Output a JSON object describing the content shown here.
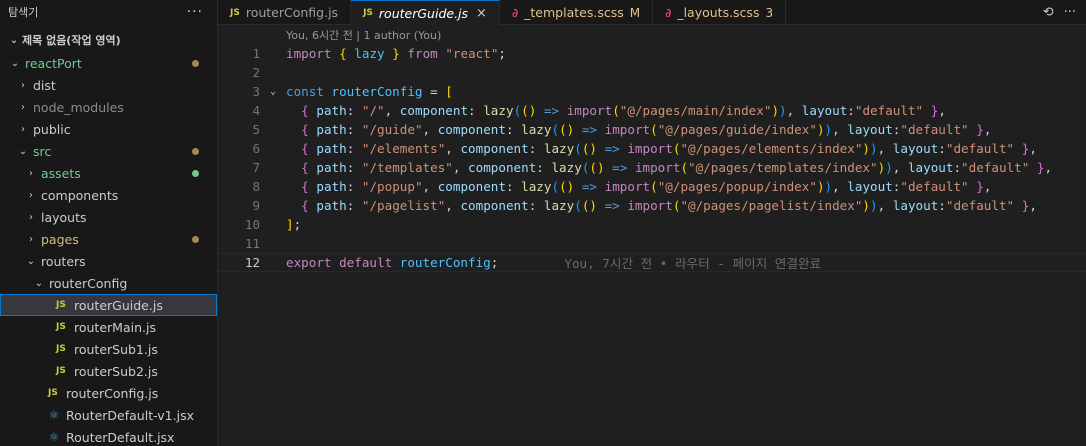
{
  "explorer": {
    "title": "탐색기",
    "more": "···",
    "workspace": "제목 없음(작업 영역)",
    "items": [
      {
        "label": "reactPort",
        "kind": "folder-open",
        "depth": 0,
        "dot": "#a08a4e",
        "color": "green"
      },
      {
        "label": "dist",
        "kind": "folder",
        "depth": 1
      },
      {
        "label": "node_modules",
        "kind": "folder",
        "depth": 1,
        "dim": true
      },
      {
        "label": "public",
        "kind": "folder",
        "depth": 1
      },
      {
        "label": "src",
        "kind": "folder-open",
        "depth": 1,
        "dot": "#a08a4e",
        "color": "green"
      },
      {
        "label": "assets",
        "kind": "folder",
        "depth": 2,
        "dot": "#73c991",
        "color": "green"
      },
      {
        "label": "components",
        "kind": "folder",
        "depth": 2
      },
      {
        "label": "layouts",
        "kind": "folder",
        "depth": 2
      },
      {
        "label": "pages",
        "kind": "folder",
        "depth": 2,
        "dot": "#a08a4e"
      },
      {
        "label": "routers",
        "kind": "folder-open",
        "depth": 2
      },
      {
        "label": "routerConfig",
        "kind": "folder-open",
        "depth": 3
      },
      {
        "label": "routerGuide.js",
        "kind": "js",
        "depth": 4,
        "selected": true
      },
      {
        "label": "routerMain.js",
        "kind": "js",
        "depth": 4
      },
      {
        "label": "routerSub1.js",
        "kind": "js",
        "depth": 4
      },
      {
        "label": "routerSub2.js",
        "kind": "js",
        "depth": 4
      },
      {
        "label": "routerConfig.js",
        "kind": "js",
        "depth": 3
      },
      {
        "label": "RouterDefault-v1.jsx",
        "kind": "react",
        "depth": 3
      },
      {
        "label": "RouterDefault.jsx",
        "kind": "react",
        "depth": 3
      }
    ]
  },
  "tabs": [
    {
      "label": "routerConfig.js",
      "icon": "js",
      "active": false
    },
    {
      "label": "routerGuide.js",
      "icon": "js",
      "active": true,
      "close": "×"
    },
    {
      "label": "_templates.scss",
      "icon": "sass",
      "active": false,
      "badge": "M"
    },
    {
      "label": "_layouts.scss",
      "icon": "sass",
      "active": false,
      "badge": "3"
    }
  ],
  "editor": {
    "codelens": "You, 6시간 전 | 1 author (You)",
    "blame": "You, 7시간 전 • 라우터 - 페이지 연결완료",
    "current_line": 12,
    "lines": [
      [
        {
          "c": "kw",
          "t": "import"
        },
        {
          "c": "txt",
          "t": " "
        },
        {
          "c": "p1",
          "t": "{"
        },
        {
          "c": "txt",
          "t": " "
        },
        {
          "c": "var",
          "t": "lazy"
        },
        {
          "c": "txt",
          "t": " "
        },
        {
          "c": "p1",
          "t": "}"
        },
        {
          "c": "txt",
          "t": " "
        },
        {
          "c": "kw",
          "t": "from"
        },
        {
          "c": "txt",
          "t": " "
        },
        {
          "c": "str",
          "t": "\"react\""
        },
        {
          "c": "txt",
          "t": ";"
        }
      ],
      [],
      [
        {
          "c": "kb",
          "t": "const"
        },
        {
          "c": "txt",
          "t": " "
        },
        {
          "c": "var",
          "t": "routerConfig"
        },
        {
          "c": "txt",
          "t": " = "
        },
        {
          "c": "p1",
          "t": "["
        }
      ],
      [
        {
          "c": "txt",
          "t": "  "
        },
        {
          "c": "p2",
          "t": "{"
        },
        {
          "c": "txt",
          "t": " "
        },
        {
          "c": "prop",
          "t": "path"
        },
        {
          "c": "txt",
          "t": ": "
        },
        {
          "c": "str",
          "t": "\"/\""
        },
        {
          "c": "txt",
          "t": ", "
        },
        {
          "c": "prop",
          "t": "component"
        },
        {
          "c": "txt",
          "t": ": "
        },
        {
          "c": "fn",
          "t": "lazy"
        },
        {
          "c": "p3",
          "t": "("
        },
        {
          "c": "p1",
          "t": "()"
        },
        {
          "c": "txt",
          "t": " "
        },
        {
          "c": "kb",
          "t": "=>"
        },
        {
          "c": "txt",
          "t": " "
        },
        {
          "c": "kw",
          "t": "import"
        },
        {
          "c": "p1",
          "t": "("
        },
        {
          "c": "str",
          "t": "\"@/pages/main/index\""
        },
        {
          "c": "p1",
          "t": ")"
        },
        {
          "c": "p3",
          "t": ")"
        },
        {
          "c": "txt",
          "t": ", "
        },
        {
          "c": "prop",
          "t": "layout"
        },
        {
          "c": "txt",
          "t": ":"
        },
        {
          "c": "str",
          "t": "\"default\""
        },
        {
          "c": "txt",
          "t": " "
        },
        {
          "c": "p2",
          "t": "}"
        },
        {
          "c": "txt",
          "t": ","
        }
      ],
      [
        {
          "c": "txt",
          "t": "  "
        },
        {
          "c": "p2",
          "t": "{"
        },
        {
          "c": "txt",
          "t": " "
        },
        {
          "c": "prop",
          "t": "path"
        },
        {
          "c": "txt",
          "t": ": "
        },
        {
          "c": "str",
          "t": "\"/guide\""
        },
        {
          "c": "txt",
          "t": ", "
        },
        {
          "c": "prop",
          "t": "component"
        },
        {
          "c": "txt",
          "t": ": "
        },
        {
          "c": "fn",
          "t": "lazy"
        },
        {
          "c": "p3",
          "t": "("
        },
        {
          "c": "p1",
          "t": "()"
        },
        {
          "c": "txt",
          "t": " "
        },
        {
          "c": "kb",
          "t": "=>"
        },
        {
          "c": "txt",
          "t": " "
        },
        {
          "c": "kw",
          "t": "import"
        },
        {
          "c": "p1",
          "t": "("
        },
        {
          "c": "str",
          "t": "\"@/pages/guide/index\""
        },
        {
          "c": "p1",
          "t": ")"
        },
        {
          "c": "p3",
          "t": ")"
        },
        {
          "c": "txt",
          "t": ", "
        },
        {
          "c": "prop",
          "t": "layout"
        },
        {
          "c": "txt",
          "t": ":"
        },
        {
          "c": "str",
          "t": "\"default\""
        },
        {
          "c": "txt",
          "t": " "
        },
        {
          "c": "p2",
          "t": "}"
        },
        {
          "c": "txt",
          "t": ","
        }
      ],
      [
        {
          "c": "txt",
          "t": "  "
        },
        {
          "c": "p2",
          "t": "{"
        },
        {
          "c": "txt",
          "t": " "
        },
        {
          "c": "prop",
          "t": "path"
        },
        {
          "c": "txt",
          "t": ": "
        },
        {
          "c": "str",
          "t": "\"/elements\""
        },
        {
          "c": "txt",
          "t": ", "
        },
        {
          "c": "prop",
          "t": "component"
        },
        {
          "c": "txt",
          "t": ": "
        },
        {
          "c": "fn",
          "t": "lazy"
        },
        {
          "c": "p3",
          "t": "("
        },
        {
          "c": "p1",
          "t": "()"
        },
        {
          "c": "txt",
          "t": " "
        },
        {
          "c": "kb",
          "t": "=>"
        },
        {
          "c": "txt",
          "t": " "
        },
        {
          "c": "kw",
          "t": "import"
        },
        {
          "c": "p1",
          "t": "("
        },
        {
          "c": "str",
          "t": "\"@/pages/elements/index\""
        },
        {
          "c": "p1",
          "t": ")"
        },
        {
          "c": "p3",
          "t": ")"
        },
        {
          "c": "txt",
          "t": ", "
        },
        {
          "c": "prop",
          "t": "layout"
        },
        {
          "c": "txt",
          "t": ":"
        },
        {
          "c": "str",
          "t": "\"default\""
        },
        {
          "c": "txt",
          "t": " "
        },
        {
          "c": "p2",
          "t": "}"
        },
        {
          "c": "txt",
          "t": ","
        }
      ],
      [
        {
          "c": "txt",
          "t": "  "
        },
        {
          "c": "p2",
          "t": "{"
        },
        {
          "c": "txt",
          "t": " "
        },
        {
          "c": "prop",
          "t": "path"
        },
        {
          "c": "txt",
          "t": ": "
        },
        {
          "c": "str",
          "t": "\"/templates\""
        },
        {
          "c": "txt",
          "t": ", "
        },
        {
          "c": "prop",
          "t": "component"
        },
        {
          "c": "txt",
          "t": ": "
        },
        {
          "c": "fn",
          "t": "lazy"
        },
        {
          "c": "p3",
          "t": "("
        },
        {
          "c": "p1",
          "t": "()"
        },
        {
          "c": "txt",
          "t": " "
        },
        {
          "c": "kb",
          "t": "=>"
        },
        {
          "c": "txt",
          "t": " "
        },
        {
          "c": "kw",
          "t": "import"
        },
        {
          "c": "p1",
          "t": "("
        },
        {
          "c": "str",
          "t": "\"@/pages/templates/index\""
        },
        {
          "c": "p1",
          "t": ")"
        },
        {
          "c": "p3",
          "t": ")"
        },
        {
          "c": "txt",
          "t": ", "
        },
        {
          "c": "prop",
          "t": "layout"
        },
        {
          "c": "txt",
          "t": ":"
        },
        {
          "c": "str",
          "t": "\"default\""
        },
        {
          "c": "txt",
          "t": " "
        },
        {
          "c": "p2",
          "t": "}"
        },
        {
          "c": "txt",
          "t": ","
        }
      ],
      [
        {
          "c": "txt",
          "t": "  "
        },
        {
          "c": "p2",
          "t": "{"
        },
        {
          "c": "txt",
          "t": " "
        },
        {
          "c": "prop",
          "t": "path"
        },
        {
          "c": "txt",
          "t": ": "
        },
        {
          "c": "str",
          "t": "\"/popup\""
        },
        {
          "c": "txt",
          "t": ", "
        },
        {
          "c": "prop",
          "t": "component"
        },
        {
          "c": "txt",
          "t": ": "
        },
        {
          "c": "fn",
          "t": "lazy"
        },
        {
          "c": "p3",
          "t": "("
        },
        {
          "c": "p1",
          "t": "()"
        },
        {
          "c": "txt",
          "t": " "
        },
        {
          "c": "kb",
          "t": "=>"
        },
        {
          "c": "txt",
          "t": " "
        },
        {
          "c": "kw",
          "t": "import"
        },
        {
          "c": "p1",
          "t": "("
        },
        {
          "c": "str",
          "t": "\"@/pages/popup/index\""
        },
        {
          "c": "p1",
          "t": ")"
        },
        {
          "c": "p3",
          "t": ")"
        },
        {
          "c": "txt",
          "t": ", "
        },
        {
          "c": "prop",
          "t": "layout"
        },
        {
          "c": "txt",
          "t": ":"
        },
        {
          "c": "str",
          "t": "\"default\""
        },
        {
          "c": "txt",
          "t": " "
        },
        {
          "c": "p2",
          "t": "}"
        },
        {
          "c": "txt",
          "t": ","
        }
      ],
      [
        {
          "c": "txt",
          "t": "  "
        },
        {
          "c": "p2",
          "t": "{"
        },
        {
          "c": "txt",
          "t": " "
        },
        {
          "c": "prop",
          "t": "path"
        },
        {
          "c": "txt",
          "t": ": "
        },
        {
          "c": "str",
          "t": "\"/pagelist\""
        },
        {
          "c": "txt",
          "t": ", "
        },
        {
          "c": "prop",
          "t": "component"
        },
        {
          "c": "txt",
          "t": ": "
        },
        {
          "c": "fn",
          "t": "lazy"
        },
        {
          "c": "p3",
          "t": "("
        },
        {
          "c": "p1",
          "t": "()"
        },
        {
          "c": "txt",
          "t": " "
        },
        {
          "c": "kb",
          "t": "=>"
        },
        {
          "c": "txt",
          "t": " "
        },
        {
          "c": "kw",
          "t": "import"
        },
        {
          "c": "p1",
          "t": "("
        },
        {
          "c": "str",
          "t": "\"@/pages/pagelist/index\""
        },
        {
          "c": "p1",
          "t": ")"
        },
        {
          "c": "p3",
          "t": ")"
        },
        {
          "c": "txt",
          "t": ", "
        },
        {
          "c": "prop",
          "t": "layout"
        },
        {
          "c": "txt",
          "t": ":"
        },
        {
          "c": "str",
          "t": "\"default\""
        },
        {
          "c": "txt",
          "t": " "
        },
        {
          "c": "p2",
          "t": "}"
        },
        {
          "c": "txt",
          "t": ","
        }
      ],
      [
        {
          "c": "p1",
          "t": "]"
        },
        {
          "c": "txt",
          "t": ";"
        }
      ],
      [],
      [
        {
          "c": "kw",
          "t": "export"
        },
        {
          "c": "txt",
          "t": " "
        },
        {
          "c": "kw",
          "t": "default"
        },
        {
          "c": "txt",
          "t": " "
        },
        {
          "c": "var",
          "t": "routerConfig"
        },
        {
          "c": "txt",
          "t": ";"
        }
      ]
    ]
  }
}
